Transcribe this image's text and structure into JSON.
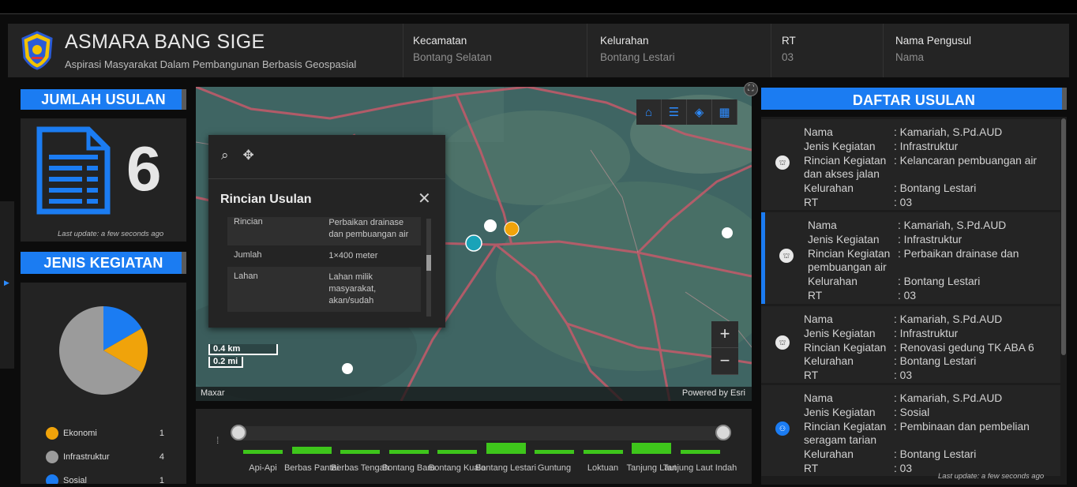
{
  "header": {
    "title": "ASMARA BANG SIGE",
    "subtitle": "Aspirasi Masyarakat Dalam Pembangunan Berbasis Geospasial",
    "fields": [
      {
        "label": "Kecamatan",
        "value": "Bontang Selatan"
      },
      {
        "label": "Kelurahan",
        "value": "Bontang Lestari"
      },
      {
        "label": "RT",
        "value": "03"
      },
      {
        "label": "Nama Pengusul",
        "value": "Nama"
      }
    ]
  },
  "jumlah": {
    "title": "JUMLAH USULAN",
    "count": "6",
    "last_update": "Last update: a few seconds ago"
  },
  "jenis": {
    "title": "JENIS KEGIATAN",
    "legend": [
      {
        "label": "Ekonomi",
        "value": "1",
        "color": "#f0a30a"
      },
      {
        "label": "Infrastruktur",
        "value": "4",
        "color": "#9b9b9b"
      },
      {
        "label": "Sosial",
        "value": "1",
        "color": "#1b7cf2"
      }
    ]
  },
  "map": {
    "attribution_left": "Maxar",
    "attribution_right": "Powered by Esri",
    "scale_km": "0.4 km",
    "scale_mi": "0.2 mi",
    "tools": [
      "home-icon",
      "list-icon",
      "layers-icon",
      "basemap-icon"
    ],
    "zoom_in": "+",
    "zoom_out": "−"
  },
  "popup": {
    "title": "Rincian Usulan",
    "close": "✕",
    "rows": [
      {
        "key": "Rincian",
        "value": "Perbaikan drainase dan pembuangan air"
      },
      {
        "key": "Jumlah",
        "value": "1×400 meter"
      },
      {
        "key": "Lahan",
        "value": "Lahan milik masyarakat, akan/sudah"
      }
    ]
  },
  "histogram": {
    "categories": [
      "Api-Api",
      "Berbas Pantai",
      "Berbas Tengah",
      "Bontang Baru",
      "Bontang Kuala",
      "Bontang Lestari",
      "Guntung",
      "Loktuan",
      "Tanjung Laut",
      "Tanjung Laut Indah"
    ],
    "values": [
      1,
      2,
      1,
      1,
      1,
      3,
      1,
      1,
      3,
      1
    ]
  },
  "daftar": {
    "title": "DAFTAR USULAN",
    "last_update": "Last update: a few seconds ago",
    "labels": {
      "nama": "Nama",
      "jenis": "Jenis Kegiatan",
      "rincian": "Rincian Kegiatan",
      "kelurahan": "Kelurahan",
      "rt": "RT"
    },
    "items": [
      {
        "nama": ": Kamariah, S.Pd.AUD",
        "jenis": ": Infrastruktur",
        "rincian": ": Kelancaran pembuangan air",
        "rincian_cont": "dan akses jalan",
        "kelurahan": ": Bontang Lestari",
        "rt": ": 03",
        "icon": "infrastructure-icon"
      },
      {
        "nama": ": Kamariah, S.Pd.AUD",
        "jenis": ": Infrastruktur",
        "rincian": ": Perbaikan drainase dan",
        "rincian_cont": "pembuangan air",
        "kelurahan": ": Bontang Lestari",
        "rt": ": 03",
        "icon": "infrastructure-icon"
      },
      {
        "nama": ": Kamariah, S.Pd.AUD",
        "jenis": ": Infrastruktur",
        "rincian": ": Renovasi gedung TK ABA 6",
        "rincian_cont": "",
        "kelurahan": ": Bontang Lestari",
        "rt": ": 03",
        "icon": "infrastructure-icon"
      },
      {
        "nama": ": Kamariah, S.Pd.AUD",
        "jenis": ": Sosial",
        "rincian": ": Pembinaan dan pembelian",
        "rincian_cont": "seragam tarian",
        "kelurahan": ": Bontang Lestari",
        "rt": ": 03",
        "icon": "social-icon"
      }
    ]
  }
}
